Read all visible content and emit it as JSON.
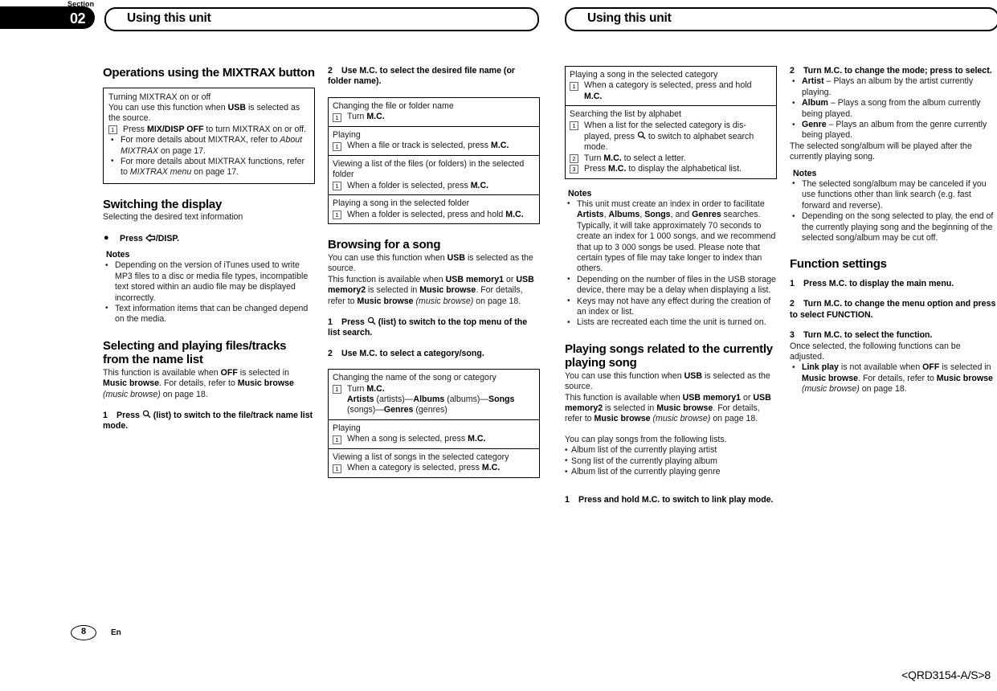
{
  "header": {
    "section_word": "Section",
    "section_number": "02",
    "tab_left_title": "Using this unit",
    "tab_right_title": "Using this unit"
  },
  "footer": {
    "page_number": "8",
    "language": "En",
    "doc_code": "<QRD3154-A/S>8"
  },
  "col1": {
    "h_operations": "Operations using the MIXTRAX button",
    "box_mixtrax": {
      "title": "Turning MIXTRAX on or off",
      "lead_a": "You can use this function when ",
      "lead_b": "USB",
      "lead_c": " is selected as the source.",
      "step1_num": "1",
      "step1_a": "Press ",
      "step1_b": "MIX/DISP OFF",
      "step1_c": " to turn MIXTRAX on or off.",
      "bullet1_a": "For more details about MIXTRAX, refer to ",
      "bullet1_i": "About MIXTRAX",
      "bullet1_b": " on page 17.",
      "bullet2_a": "For more details about MIXTRAX functions, refer to ",
      "bullet2_i": "MIXTRAX menu",
      "bullet2_b": " on page 17."
    },
    "h_switching": "Switching the display",
    "switching_sub": "Selecting the desired text information",
    "press_disp_a": "Press ",
    "press_disp_b": "/DISP.",
    "notes_title": "Notes",
    "note1": "Depending on the version of iTunes used to write MP3 files to a disc or media file types, incompatible text stored within an audio file may be displayed incorrectly.",
    "note2": "Text information items that can be changed depend on the media.",
    "h_selecting": "Selecting and playing files/tracks from the name list",
    "sel_p1_a": "This function is available when ",
    "sel_p1_b": "OFF",
    "sel_p1_c": " is selected in ",
    "sel_p1_d": "Music browse",
    "sel_p1_e": ". For details, refer to ",
    "sel_p1_f": "Music browse",
    "sel_p1_g": " (music browse)",
    "sel_p1_h": " on page 18.",
    "step1_num": "1",
    "step1_a": "Press ",
    "step1_b": " (list) to switch to the file/track name list mode."
  },
  "col2": {
    "step2_num": "2",
    "step2_text": "Use M.C. to select the desired file name (or folder name).",
    "box_rows": [
      {
        "title": "Changing the file or folder name",
        "num": "1",
        "item_a": "Turn ",
        "item_b": "M.C.",
        "item_c": ""
      },
      {
        "title": "Playing",
        "num": "1",
        "item_a": "When a file or track is selected, press ",
        "item_b": "M.C.",
        "item_c": ""
      },
      {
        "title": "Viewing a list of the files (or folders) in the selected folder",
        "num": "1",
        "item_a": "When a folder is selected, press ",
        "item_b": "M.C.",
        "item_c": ""
      },
      {
        "title": "Playing a song in the selected folder",
        "num": "1",
        "item_a": "When a folder is selected, press and hold ",
        "item_b": "M.C.",
        "item_c": ""
      }
    ],
    "h_browsing": "Browsing for a song",
    "br_p1_a": "You can use this function when ",
    "br_p1_b": "USB",
    "br_p1_c": " is selected as the source.",
    "br_p2_a": "This function is available when ",
    "br_p2_b": "USB memory1",
    "br_p2_c": " or ",
    "br_p2_d": "USB memory2",
    "br_p2_e": " is selected in ",
    "br_p2_f": "Music browse",
    "br_p2_g": ". For details, refer to ",
    "br_p2_h": "Music browse",
    "br_p2_i": " (music browse)",
    "br_p2_j": " on page 18.",
    "step1_num": "1",
    "step1_a": "Press ",
    "step1_b": " (list) to switch to the top menu of the list search.",
    "step2b_num": "2",
    "step2b_text": "Use M.C. to select a category/song.",
    "box2_rows": [
      {
        "title": "Changing the name of the song or category",
        "num": "1",
        "item_a": "Turn ",
        "item_b": "M.C.",
        "sub_1": "Artists",
        "sub_2": " (artists)—",
        "sub_3": "Albums",
        "sub_4": " (albums)—",
        "sub_5": "Songs",
        "sub_6": " (songs)—",
        "sub_7": "Genres",
        "sub_8": " (genres)"
      },
      {
        "title": "Playing",
        "num": "1",
        "item_a": "When a song is selected, press ",
        "item_b": "M.C."
      },
      {
        "title": "Viewing a list of songs in the selected category",
        "num": "1",
        "item_a": "When a category is selected, press ",
        "item_b": "M.C."
      }
    ]
  },
  "col3": {
    "box_row1": {
      "title": "Playing a song in the selected category",
      "num": "1",
      "item_a": "When a category is selected, press and hold",
      "item_b": "M.C."
    },
    "box_row2": {
      "title": "Searching the list by alphabet",
      "num1": "1",
      "item1_a": "When a list for the selected category is dis-played, press ",
      "item1_b": " to switch to alphabet search mode.",
      "num2": "2",
      "item2_a": "Turn ",
      "item2_b": "M.C.",
      "item2_c": " to select a letter.",
      "num3": "3",
      "item3_a": "Press ",
      "item3_b": "M.C.",
      "item3_c": " to display the alphabetical list."
    },
    "notes_title": "Notes",
    "note1_a": "This unit must create an index in order to facilitate ",
    "note1_b": "Artists",
    "note1_c": ", ",
    "note1_d": "Albums",
    "note1_e": ", ",
    "note1_f": "Songs",
    "note1_g": ", and ",
    "note1_h": "Genres",
    "note1_i": " searches. Typically, it will take approximately 70 seconds to create an index for 1 000 songs, and we recommend that up to 3 000 songs be used. Please note that certain types of file may take longer to index than others.",
    "note2": "Depending on the number of files in the USB storage device, there may be a delay when displaying a list.",
    "note3": "Keys may not have any effect during the creation of an index or list.",
    "note4": "Lists are recreated each time the unit is turned on.",
    "h_playing_related": "Playing songs related to the currently playing song",
    "pr_p1_a": "You can use this function when ",
    "pr_p1_b": "USB",
    "pr_p1_c": " is selected as the source.",
    "pr_p2_a": "This function is available when ",
    "pr_p2_b": "USB memory1",
    "pr_p2_c": " or ",
    "pr_p2_d": "USB memory2",
    "pr_p2_e": " is selected in ",
    "pr_p2_f": "Music browse",
    "pr_p2_g": ". For details, refer to ",
    "pr_p2_h": "Music browse",
    "pr_p2_i": " (music browse)",
    "pr_p2_j": " on page 18.",
    "lists_lead": "You can play songs from the following lists.",
    "list_items": [
      "Album list of the currently playing artist",
      "Song list of the currently playing album",
      "Album list of the currently playing genre"
    ],
    "step1_num": "1",
    "step1_text": "Press and hold M.C. to switch to link play mode."
  },
  "col4": {
    "step2_num": "2",
    "step2_text": "Turn M.C. to change the mode; press to select.",
    "mode_items": [
      {
        "name": "Artist",
        "desc": " – Plays an album by the artist currently playing."
      },
      {
        "name": "Album",
        "desc": " – Plays a song from the album currently being played."
      },
      {
        "name": "Genre",
        "desc": " – Plays an album from the genre currently being played."
      }
    ],
    "after_modes": "The selected song/album will be played after the currently playing song.",
    "notes_title": "Notes",
    "note1": "The selected song/album may be canceled if you use functions other than link search (e.g. fast forward and reverse).",
    "note2": "Depending on the song selected to play, the end of the currently playing song and the beginning of the selected song/album may be cut off.",
    "h_function_settings": "Function settings",
    "fs_step1_num": "1",
    "fs_step1_text": "Press M.C. to display the main menu.",
    "fs_step2_num": "2",
    "fs_step2_text": "Turn M.C. to change the menu option and press to select FUNCTION.",
    "fs_step3_num": "3",
    "fs_step3_text": "Turn M.C. to select the function.",
    "fs_after": "Once selected, the following functions can be adjusted.",
    "fs_bullet_a": "Link play",
    "fs_bullet_b": " is not available when ",
    "fs_bullet_c": "OFF",
    "fs_bullet_d": " is selected in ",
    "fs_bullet_e": "Music browse",
    "fs_bullet_f": ". For details, refer to ",
    "fs_bullet_g": "Music browse",
    "fs_bullet_h": " (music browse)",
    "fs_bullet_i": " on page 18."
  },
  "icons": {
    "back_disp": "back-arrow-icon",
    "list_search": "magnifier-list-icon"
  },
  "colors": {
    "ink": "#000000",
    "body_text": "#1a1a1a",
    "paper": "#ffffff"
  }
}
